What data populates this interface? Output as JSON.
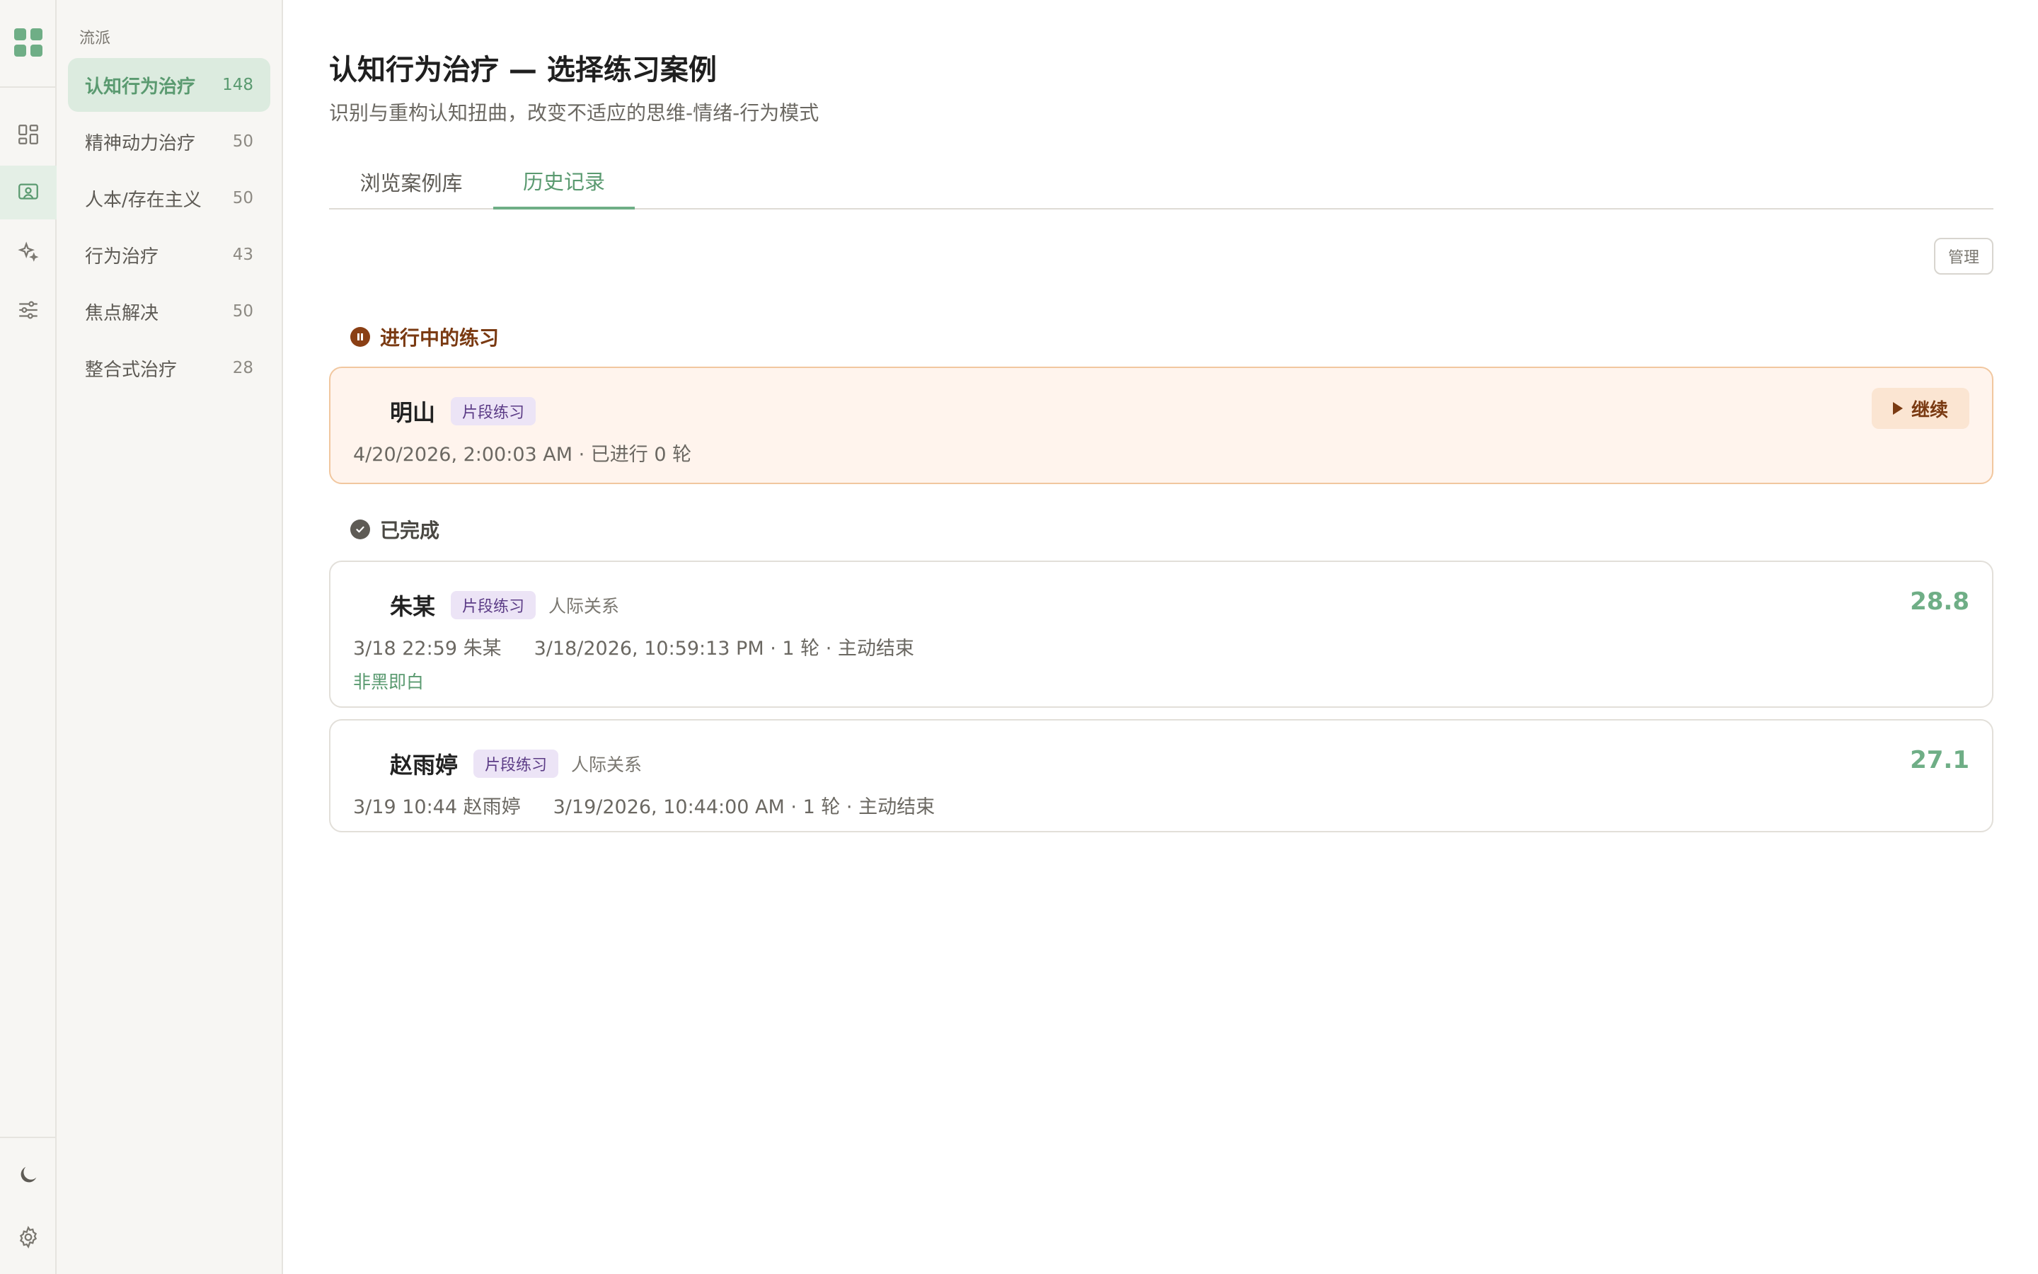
{
  "sidebar": {
    "section_label": "流派",
    "items": [
      {
        "label": "认知行为治疗",
        "count": "148",
        "active": true
      },
      {
        "label": "精神动力治疗",
        "count": "50"
      },
      {
        "label": "人本/存在主义",
        "count": "50"
      },
      {
        "label": "行为治疗",
        "count": "43"
      },
      {
        "label": "焦点解决",
        "count": "50"
      },
      {
        "label": "整合式治疗",
        "count": "28"
      }
    ]
  },
  "header": {
    "title": "认知行为治疗 — 选择练习案例",
    "subtitle": "识别与重构认知扭曲，改变不适应的思维-情绪-行为模式"
  },
  "tabs": [
    {
      "label": "浏览案例库"
    },
    {
      "label": "历史记录",
      "active": true
    }
  ],
  "manage_label": "管理",
  "ongoing": {
    "heading": "进行中的练习",
    "card": {
      "name": "明山",
      "tag": "片段练习",
      "meta": "4/20/2026, 2:00:03 AM · 已进行 0 轮",
      "continue_label": "继续"
    }
  },
  "completed": {
    "heading": "已完成",
    "cards": [
      {
        "name": "朱某",
        "tag": "片段练习",
        "topic": "人际关系",
        "session": "3/18 22:59 朱某",
        "meta": "3/18/2026, 10:59:13 PM · 1 轮 · 主动结束",
        "note": "非黑即白",
        "score": "28.8"
      },
      {
        "name": "赵雨婷",
        "tag": "片段练习",
        "topic": "人际关系",
        "session": "3/19 10:44 赵雨婷",
        "meta": "3/19/2026, 10:44:00 AM · 1 轮 · 主动结束",
        "score": "27.1"
      }
    ]
  },
  "colors": {
    "accent": "#6fae86",
    "ongoing_bg": "#fff4ed",
    "ongoing_border": "#f1c79f",
    "tag_bg": "#ece4f6"
  }
}
